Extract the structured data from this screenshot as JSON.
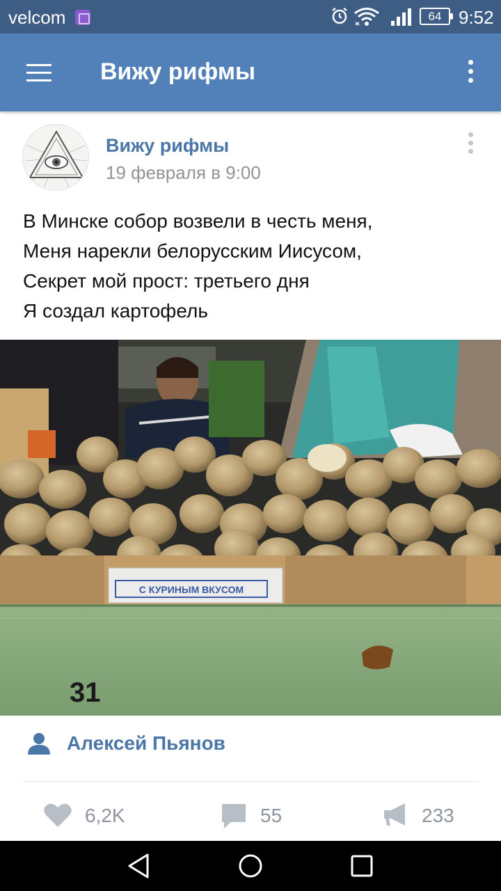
{
  "status_bar": {
    "carrier": "velcom",
    "battery": "64",
    "time": "9:52"
  },
  "app_bar": {
    "title": "Вижу рифмы"
  },
  "post": {
    "author": "Вижу рифмы",
    "date": "19 февраля в 9:00",
    "text_lines": [
      "В Минске собор возвели в честь меня,",
      "Меня нарекли белорусским Иисусом,",
      "Секрет мой прост: третьего дня",
      "Я создал картофель"
    ],
    "photo": {
      "sign_text": "С КУРИНЫМ ВКУСОМ",
      "counter_number": "31"
    },
    "signer": "Алексей Пьянов",
    "likes": "6,2K",
    "comments": "55",
    "shares": "233"
  },
  "colors": {
    "status_bar": "#3e5d84",
    "app_bar": "#5181b8",
    "link": "#4a76a8",
    "muted": "#939393"
  },
  "icons": {
    "menu": "hamburger-icon",
    "more": "more-vertical-icon",
    "user": "user-icon",
    "like": "heart-icon",
    "comment": "comment-icon",
    "share": "megaphone-icon"
  }
}
